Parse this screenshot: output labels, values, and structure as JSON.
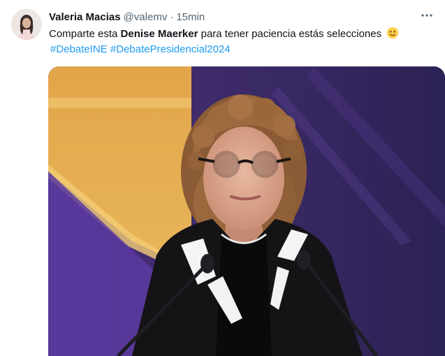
{
  "tweet": {
    "author_name": "Valeria Macias",
    "handle": "@valemv",
    "separator": "·",
    "time": "15min",
    "more_icon": "more-horizontal-icon",
    "text_before": "Comparte esta ",
    "text_bold": "Denise Maerker",
    "text_after": " para tener paciencia estás selecciones",
    "emoji": "slightly-smiling-face-emoji",
    "hashtags": [
      "#DebateINE",
      "#DebatePresidencial2024"
    ]
  },
  "colors": {
    "link": "#1d9bf0",
    "secondary_text": "#536471",
    "primary_text": "#0f1419"
  }
}
